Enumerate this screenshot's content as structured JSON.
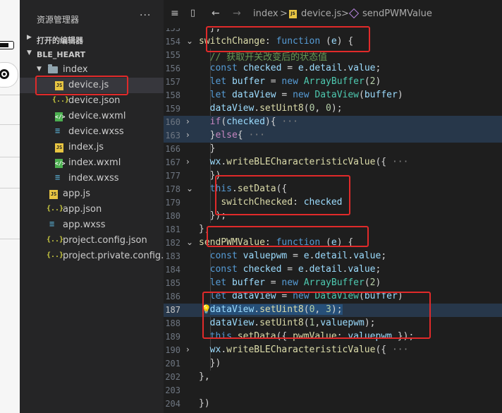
{
  "sidebar": {
    "title": "资源管理器",
    "more": "···",
    "open_editors": "打开的编辑器",
    "project": "BLE_HEART",
    "files": [
      {
        "name": "index",
        "type": "folder"
      },
      {
        "name": "device.js",
        "type": "js"
      },
      {
        "name": "device.json",
        "type": "json"
      },
      {
        "name": "device.wxml",
        "type": "wxml"
      },
      {
        "name": "device.wxss",
        "type": "wxss"
      },
      {
        "name": "index.js",
        "type": "js"
      },
      {
        "name": "index.wxml",
        "type": "wxml"
      },
      {
        "name": "index.wxss",
        "type": "wxss"
      },
      {
        "name": "app.js",
        "type": "js"
      },
      {
        "name": "app.json",
        "type": "json"
      },
      {
        "name": "app.wxss",
        "type": "wxss"
      },
      {
        "name": "project.config.json",
        "type": "json"
      },
      {
        "name": "project.private.config.js...",
        "type": "json"
      }
    ],
    "icons": {
      "js": "JS",
      "json": "{..}",
      "wxml": "</>",
      "wxss": "≡"
    }
  },
  "breadcrumb": {
    "list_icon": "≡",
    "bookmark_icon": "▯",
    "back": "←",
    "forward": "→",
    "folder": "index",
    "sep": ">",
    "file": "device.js",
    "symbol": "sendPWMValue"
  },
  "editor": {
    "lines": [
      {
        "n": "153",
        "fold": "",
        "code": "  },"
      },
      {
        "n": "154",
        "fold": "⌄",
        "code": "switchChange: function (e) {"
      },
      {
        "n": "155",
        "fold": "",
        "code": "  // 获取开关改变后的状态值"
      },
      {
        "n": "156",
        "fold": "",
        "code": "  const checked = e.detail.value;"
      },
      {
        "n": "157",
        "fold": "",
        "code": "  let buffer = new ArrayBuffer(2)"
      },
      {
        "n": "158",
        "fold": "",
        "code": "  let dataView = new DataView(buffer)"
      },
      {
        "n": "159",
        "fold": "",
        "code": "  dataView.setUint8(0, 0);"
      },
      {
        "n": "160",
        "fold": "›",
        "code": "  if(checked){ ···"
      },
      {
        "n": "163",
        "fold": "›",
        "code": "  }else{ ···"
      },
      {
        "n": "166",
        "fold": "",
        "code": "  }"
      },
      {
        "n": "167",
        "fold": "›",
        "code": "  wx.writeBLECharacteristicValue({ ···"
      },
      {
        "n": "177",
        "fold": "",
        "code": "  })"
      },
      {
        "n": "178",
        "fold": "⌄",
        "code": "  this.setData({"
      },
      {
        "n": "179",
        "fold": "",
        "code": "    switchChecked: checked"
      },
      {
        "n": "180",
        "fold": "",
        "code": "  });"
      },
      {
        "n": "181",
        "fold": "",
        "code": "},"
      },
      {
        "n": "182",
        "fold": "⌄",
        "code": "sendPWMValue: function (e) {"
      },
      {
        "n": "183",
        "fold": "",
        "code": "  const valuepwm = e.detail.value;"
      },
      {
        "n": "184",
        "fold": "",
        "code": "  const checked = e.detail.value;"
      },
      {
        "n": "185",
        "fold": "",
        "code": "  let buffer = new ArrayBuffer(2)"
      },
      {
        "n": "186",
        "fold": "",
        "code": "  let dataView = new DataView(buffer)"
      },
      {
        "n": "187",
        "fold": "",
        "code": "  dataView.setUint8(0, 3);"
      },
      {
        "n": "188",
        "fold": "",
        "code": "  dataView.setUint8(1,valuepwm);"
      },
      {
        "n": "189",
        "fold": "",
        "code": "  this.setData({ pwmValue: valuepwm });"
      },
      {
        "n": "190",
        "fold": "›",
        "code": "  wx.writeBLECharacteristicValue({ ···"
      },
      {
        "n": "201",
        "fold": "",
        "code": "  })"
      },
      {
        "n": "202",
        "fold": "",
        "code": "},"
      },
      {
        "n": "203",
        "fold": "",
        "code": ""
      },
      {
        "n": "204",
        "fold": "",
        "code": "})"
      }
    ],
    "bulb_icon": "💡"
  }
}
